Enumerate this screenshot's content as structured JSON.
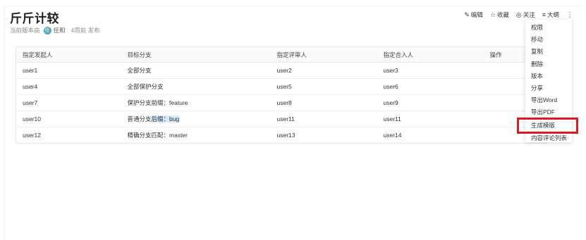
{
  "doc": {
    "title": "斤斤计较",
    "meta_prefix": "当前版本由",
    "avatar_letter": "任",
    "author": "任和",
    "meta_time": "4周前 发布"
  },
  "toolbar": {
    "edit": "编辑",
    "favorite": "收藏",
    "follow": "关注",
    "outline": "大纲",
    "more": "⋮"
  },
  "table": {
    "headers": [
      "指定发起人",
      "目标分支",
      "指定评审人",
      "指定合入人",
      "操作"
    ],
    "rows": [
      [
        "user1",
        "全部分支",
        "user2",
        "user3",
        ""
      ],
      [
        "user4",
        "全部保护分支",
        "user5",
        "user6",
        ""
      ],
      [
        "user7",
        "保护分支前缀：feature",
        "user8",
        "user9",
        ""
      ],
      [
        "user10",
        "普通分支后缀：bug",
        "user11",
        "user11",
        ""
      ],
      [
        "user12",
        "精确分支匹配：master",
        "user13",
        "user14",
        ""
      ]
    ],
    "row4_parts": [
      "普通分支",
      "后缀：bug"
    ]
  },
  "menu": {
    "items": [
      "权限",
      "移动",
      "复制",
      "删除",
      "版本",
      "分享",
      "导出Word",
      "导出PDF",
      "生成模版",
      "内容评论列表"
    ],
    "highlighted": "生成模版"
  },
  "colors": {
    "accent": "#4a7bd6",
    "highlight_box": "#e0191f",
    "avatar": "#4fa6b8",
    "text_selection": "#d4e8fb"
  }
}
